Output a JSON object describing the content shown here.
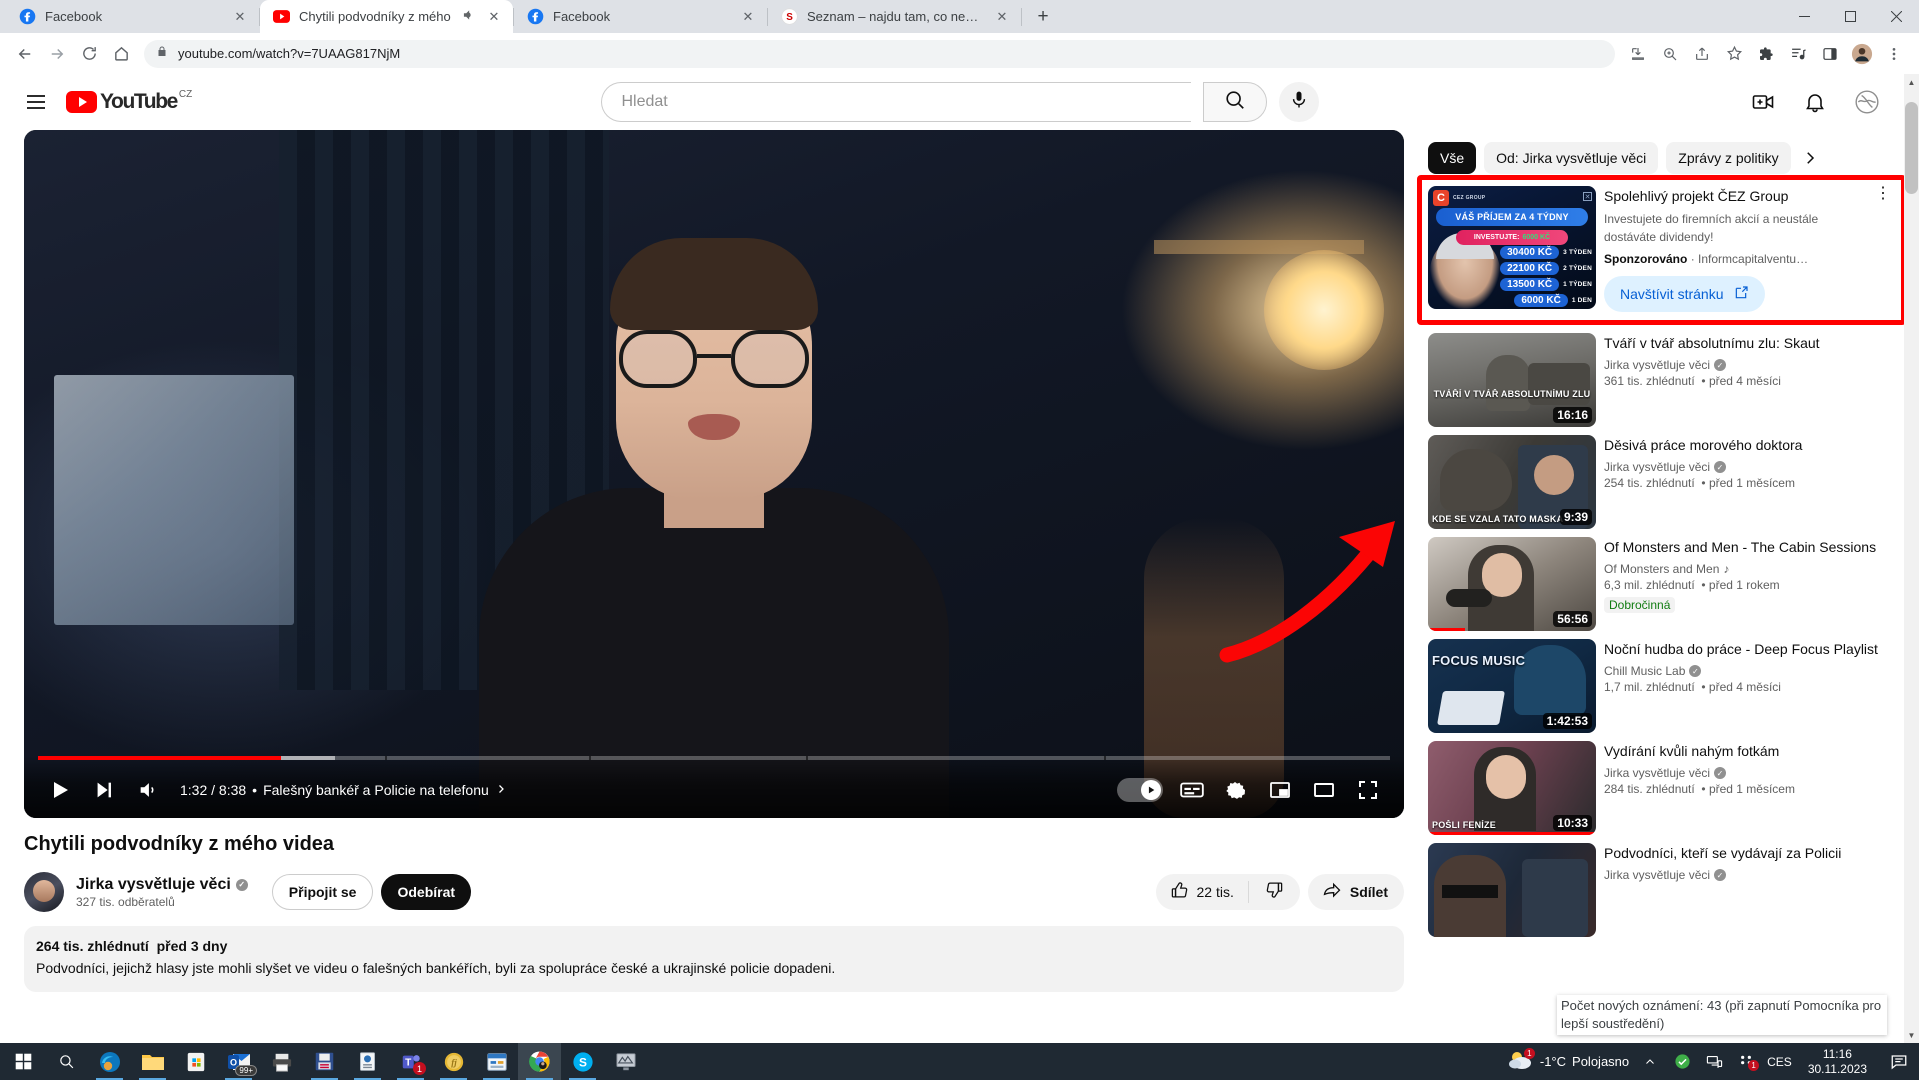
{
  "browser": {
    "tabs": [
      {
        "title": "Facebook",
        "favicon": "facebook-icon",
        "active": false,
        "audio": false
      },
      {
        "title": "Chytili podvodníky z mého",
        "favicon": "youtube-icon",
        "active": true,
        "audio": true
      },
      {
        "title": "Facebook",
        "favicon": "facebook-icon",
        "active": false,
        "audio": false
      },
      {
        "title": "Seznam – najdu tam, co neznám",
        "favicon": "seznam-icon",
        "active": false,
        "audio": false
      }
    ],
    "new_tab_label": "+",
    "window_controls": {
      "minimize": "—",
      "maximize": "▢",
      "close": "✕"
    },
    "nav": {
      "back": "back-icon",
      "forward": "forward-icon",
      "reload": "reload-icon",
      "home": "home-icon"
    },
    "omnibox": {
      "lock": "lock-icon",
      "url": "youtube.com/watch?v=7UAAG817NjM"
    },
    "toolbar_icons": [
      "install-icon",
      "zoom-icon",
      "share-icon",
      "bookmark-star-icon",
      "extensions-puzzle-icon",
      "media-list-icon",
      "side-panel-icon",
      "profile-avatar-icon",
      "chrome-menu-icon"
    ]
  },
  "youtube": {
    "header": {
      "menu_icon": "hamburger-icon",
      "logo_text": "YouTube",
      "logo_country": "CZ",
      "search_placeholder": "Hledat",
      "search_icon": "search-icon",
      "mic_icon": "microphone-icon",
      "create_icon": "create-video-icon",
      "notifications_icon": "bell-icon",
      "account_icon": "account-avatar-icon"
    },
    "player": {
      "play_icon": "play-icon",
      "next_icon": "next-track-icon",
      "volume_icon": "volume-icon",
      "time": "1:32 / 8:38",
      "separator": "•",
      "chapter": "Falešný bankéř a Policie na telefonu",
      "chapter_arrow": "chevron-right-icon",
      "autoplay_icon": "autoplay-toggle",
      "subtitles_icon": "subtitles-icon",
      "settings_icon": "gear-icon",
      "miniplayer_icon": "miniplayer-icon",
      "theater_icon": "theater-mode-icon",
      "fullscreen_icon": "fullscreen-icon",
      "progress_percent": 18,
      "buffer_percent": 22,
      "accent_color": "#ff0000"
    },
    "video": {
      "title": "Chytili podvodníky z mého videa",
      "channel": "Jirka vysvětluje věci",
      "channel_verified": "✓",
      "subscribers": "327 tis. odběratelů",
      "join_label": "Připojit se",
      "subscribe_label": "Odebírat",
      "like_count": "22 tis.",
      "like_icon": "thumbs-up-icon",
      "dislike_icon": "thumbs-down-icon",
      "share_label": "Sdílet",
      "share_icon": "share-arrow-icon",
      "views": "264 tis. zhlédnutí",
      "published": "před 3 dny",
      "description": "Podvodníci, jejichž hlasy jste mohli slyšet ve videu o falešných bankéřích, byli za spolupráce české a ukrajinské policie dopadeni."
    },
    "sidebar": {
      "chips": [
        {
          "label": "Vše",
          "active": true
        },
        {
          "label": "Od: Jirka vysvětluje věci",
          "active": false
        },
        {
          "label": "Zprávy z politiky",
          "active": false
        }
      ],
      "chip_next_icon": "chevron-right-icon",
      "ad": {
        "highlight_color": "#ff0000",
        "title": "Spolehlivý projekt ČEZ Group",
        "body": "Investujete do firemních akcií a neustále dostáváte dividendy!",
        "sponsored_label": "Sponzorováno",
        "sponsored_sep": "·",
        "advertiser": "Informcapitalventu…",
        "cta_label": "Navštívit stránku",
        "cta_icon": "external-link-icon",
        "menu_icon": "kebab-menu-icon",
        "thumb": {
          "brand": "CEZ GROUP",
          "brand_mark": "C",
          "banner": "VÁŠ PŘÍJEM ZA 4 TÝDNY",
          "invest_label": "INVESTUJTE:",
          "invest_amount": "6000 KČ",
          "close_icon": "ad-close-icon",
          "rows": [
            {
              "amount": "30400 KČ",
              "period": "3 TÝDEN"
            },
            {
              "amount": "22100 KČ",
              "period": "2 TÝDEN"
            },
            {
              "amount": "13500 KČ",
              "period": "1 TÝDEN"
            },
            {
              "amount": "6000 KČ",
              "period": "1 DEN"
            }
          ]
        }
      },
      "recommendations": [
        {
          "title": "Tváří v tvář absolutnímu zlu: Skaut",
          "channel": "Jirka vysvětluje věci",
          "verified": true,
          "views": "361 tis. zhlédnutí",
          "age": "před 4 měsíci",
          "duration": "16:16",
          "thumb_caption": "TVÁŘÍ V TVÁŘ ABSOLUTNÍMU ZLU",
          "badge": "",
          "watched_percent": 0
        },
        {
          "title": "Děsivá práce morového doktora",
          "channel": "Jirka vysvětluje věci",
          "verified": true,
          "views": "254 tis. zhlédnutí",
          "age": "před 1 měsícem",
          "duration": "9:39",
          "thumb_caption": "KDE SE VZALA TATO MASKA",
          "badge": "",
          "watched_percent": 0
        },
        {
          "title": "Of Monsters and Men - The Cabin Sessions",
          "channel": "Of Monsters and Men",
          "verified": false,
          "music_note": "♪",
          "views": "6,3 mil. zhlédnutí",
          "age": "před 1 rokem",
          "duration": "56:56",
          "thumb_caption": "",
          "badge": "Dobročinná",
          "watched_percent": 22
        },
        {
          "title": "Noční hudba do práce - Deep Focus Playlist",
          "channel": "Chill Music Lab",
          "verified": true,
          "views": "1,7 mil. zhlédnutí",
          "age": "před 4 měsíci",
          "duration": "1:42:53",
          "thumb_caption": "FOCUS MUSIC",
          "badge": "",
          "watched_percent": 0
        },
        {
          "title": "Vydírání kvůli nahým fotkám",
          "channel": "Jirka vysvětluje věci",
          "verified": true,
          "views": "284 tis. zhlédnutí",
          "age": "před 1 měsícem",
          "duration": "10:33",
          "thumb_caption": "POŠLI FENÍZE",
          "badge": "",
          "watched_percent": 100
        },
        {
          "title": "Podvodníci, kteří se vydávají za Policii",
          "channel": "Jirka vysvětluje věci",
          "verified": true,
          "views": "",
          "age": "",
          "duration": "",
          "thumb_caption": "",
          "badge": "",
          "watched_percent": 0
        }
      ]
    },
    "tooltip": "Počet nových oznámení: 43 (při zapnutí Pomocníka pro lepší soustředění)"
  },
  "taskbar": {
    "start_icon": "windows-start-icon",
    "search_icon": "taskbar-search-icon",
    "apps": [
      {
        "name": "edge-icon",
        "active": false,
        "running": true,
        "badge": ""
      },
      {
        "name": "file-explorer-icon",
        "active": false,
        "running": true,
        "badge": ""
      },
      {
        "name": "microsoft-store-icon",
        "active": false,
        "running": false,
        "badge": ""
      },
      {
        "name": "outlook-icon",
        "active": false,
        "running": true,
        "badge": "99+"
      },
      {
        "name": "printer-icon",
        "active": false,
        "running": false,
        "badge": ""
      },
      {
        "name": "save-app-icon",
        "active": false,
        "running": true,
        "badge": ""
      },
      {
        "name": "document-app-icon",
        "active": false,
        "running": true,
        "badge": ""
      },
      {
        "name": "microsoft-teams-icon",
        "active": false,
        "running": true,
        "badge": "1"
      },
      {
        "name": "coin-app-icon",
        "active": false,
        "running": true,
        "badge": ""
      },
      {
        "name": "calendar-app-icon",
        "active": false,
        "running": true,
        "badge": ""
      },
      {
        "name": "google-chrome-icon",
        "active": true,
        "running": true,
        "badge": ""
      },
      {
        "name": "skype-icon",
        "active": false,
        "running": true,
        "badge": ""
      },
      {
        "name": "monitor-app-icon",
        "active": false,
        "running": false,
        "badge": ""
      }
    ],
    "tray": {
      "weather_icon": "weather-partly-cloudy-icon",
      "weather_badge": "1",
      "temperature": "-1°C",
      "weather_text": "Polojasno",
      "chevron_icon": "chevron-up-icon",
      "shield_icon": "security-ok-icon",
      "network_icon": "network-icon",
      "battery_or_app_icon": "tray-app-icon",
      "tray_badge": "1",
      "language": "CES",
      "time": "11:16",
      "date": "30.11.2023",
      "notifications_icon": "action-center-icon"
    }
  }
}
